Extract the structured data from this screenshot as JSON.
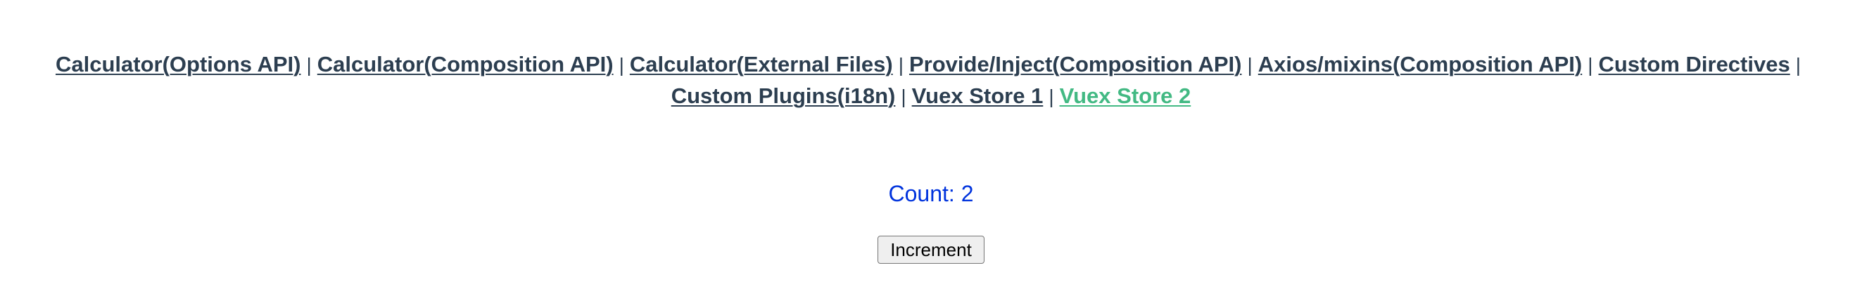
{
  "nav": {
    "links": [
      {
        "label": "Calculator(Options API)",
        "active": false
      },
      {
        "label": "Calculator(Composition API)",
        "active": false
      },
      {
        "label": "Calculator(External Files)",
        "active": false
      },
      {
        "label": "Provide/Inject(Composition API)",
        "active": false
      },
      {
        "label": "Axios/mixins(Composition API)",
        "active": false
      },
      {
        "label": "Custom Directives",
        "active": false
      },
      {
        "label": "Custom Plugins(i18n)",
        "active": false
      },
      {
        "label": "Vuex Store 1",
        "active": false
      },
      {
        "label": "Vuex Store 2",
        "active": true
      }
    ],
    "separator": "|"
  },
  "counter": {
    "text": "Count: 2"
  },
  "button": {
    "label": "Increment"
  },
  "colors": {
    "link": "#2c3e50",
    "active_link": "#42b983",
    "count_text": "#0033dd"
  }
}
